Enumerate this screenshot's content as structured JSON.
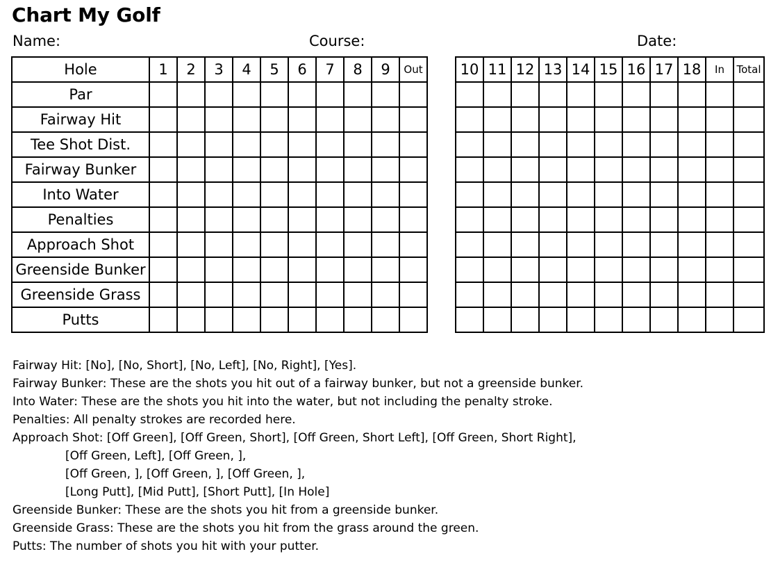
{
  "title": "Chart My Golf",
  "header_fields": [
    {
      "name": "name",
      "label": "Name:"
    },
    {
      "name": "course",
      "label": "Course:"
    },
    {
      "name": "date",
      "label": "Date:"
    }
  ],
  "row_labels": [
    "Hole",
    "Par",
    "Fairway Hit",
    "Tee Shot Dist.",
    "Fairway Bunker",
    "Into Water",
    "Penalties",
    "Approach Shot",
    "Greenside Bunker",
    "Greenside Grass",
    "Putts"
  ],
  "front_nine": {
    "holes": [
      "1",
      "2",
      "3",
      "4",
      "5",
      "6",
      "7",
      "8",
      "9"
    ],
    "summary_columns": [
      "Out"
    ]
  },
  "back_nine": {
    "holes": [
      "10",
      "11",
      "12",
      "13",
      "14",
      "15",
      "16",
      "17",
      "18"
    ],
    "summary_columns": [
      "In",
      "Total"
    ]
  },
  "legend": [
    {
      "text": "Fairway Hit: [No], [No, Short], [No, Left], [No, Right], [Yes].",
      "indent": false
    },
    {
      "text": "Fairway Bunker: These are the shots you hit out of a fairway bunker, but not a greenside bunker.",
      "indent": false
    },
    {
      "text": "Into Water: These are the shots you hit into the water, but not including the penalty stroke.",
      "indent": false
    },
    {
      "text": "Penalties: All penalty strokes are recorded here.",
      "indent": false
    },
    {
      "text": "Approach Shot: [Off Green], [Off Green, Short], [Off Green, Short Left], [Off Green, Short Right],",
      "indent": false
    },
    {
      "text": "[Off Green, Left], [Off Green, ],",
      "indent": true
    },
    {
      "text": "[Off Green, ], [Off Green, ], [Off Green, ],",
      "indent": true
    },
    {
      "text": "[Long Putt], [Mid Putt], [Short Putt], [In Hole]",
      "indent": true
    },
    {
      "text": "Greenside Bunker: These are the shots you hit from a greenside bunker.",
      "indent": false
    },
    {
      "text": "Greenside Grass: These are the shots you hit from the grass around the green.",
      "indent": false
    },
    {
      "text": "Putts: The number of shots you hit with your putter.",
      "indent": false
    }
  ],
  "colors": {
    "ink": "#000000",
    "paper": "#ffffff"
  }
}
